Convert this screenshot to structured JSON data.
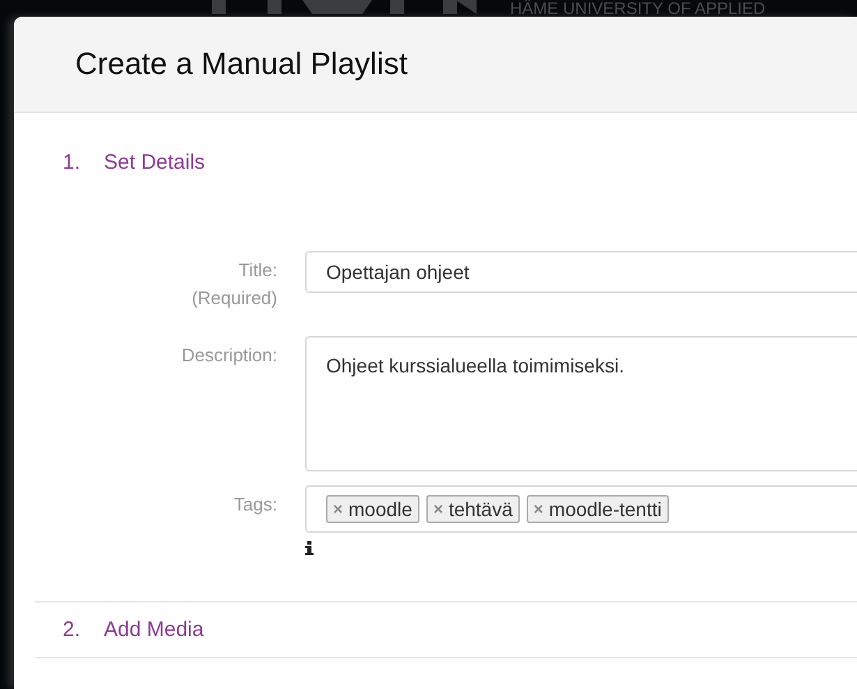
{
  "backdrop": {
    "tagline": "HÄME UNIVERSITY OF APPLIED"
  },
  "dialog": {
    "title": "Create a Manual Playlist"
  },
  "steps": [
    {
      "number": "1.",
      "title": "Set Details"
    },
    {
      "number": "2.",
      "title": "Add Media"
    }
  ],
  "form": {
    "title_label": "Title:",
    "title_note": "(Required)",
    "title_value": "Opettajan ohjeet",
    "description_label": "Description:",
    "description_value": "Ohjeet kurssialueella toimimiseksi.",
    "tags_label": "Tags:",
    "tags": [
      {
        "label": "moodle",
        "remove": "×"
      },
      {
        "label": "tehtävä",
        "remove": "×"
      },
      {
        "label": "moodle-tentti",
        "remove": "×"
      }
    ]
  }
}
